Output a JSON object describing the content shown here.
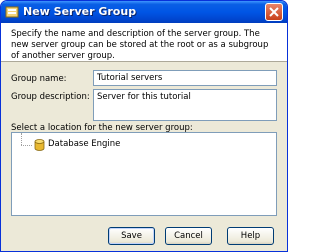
{
  "window": {
    "title": "New Server Group"
  },
  "description": "Specify the name and description of the server group. The new server group can be stored at the root or as a subgroup of another server group.",
  "form": {
    "group_name_label": "Group name:",
    "group_name_value": "Tutorial servers",
    "group_description_label": "Group description:",
    "group_description_value": "Server for this tutorial",
    "location_label": "Select a location for the new server group:"
  },
  "tree": {
    "items": [
      {
        "label": "Database Engine",
        "icon": "database-cylinder-icon"
      }
    ]
  },
  "buttons": {
    "save": "Save",
    "cancel": "Cancel",
    "help": "Help"
  },
  "colors": {
    "titlebar": "#0055e5",
    "dialog_bg": "#ece9d8",
    "close_button": "#c8401a",
    "db_icon": "#e8b830"
  }
}
